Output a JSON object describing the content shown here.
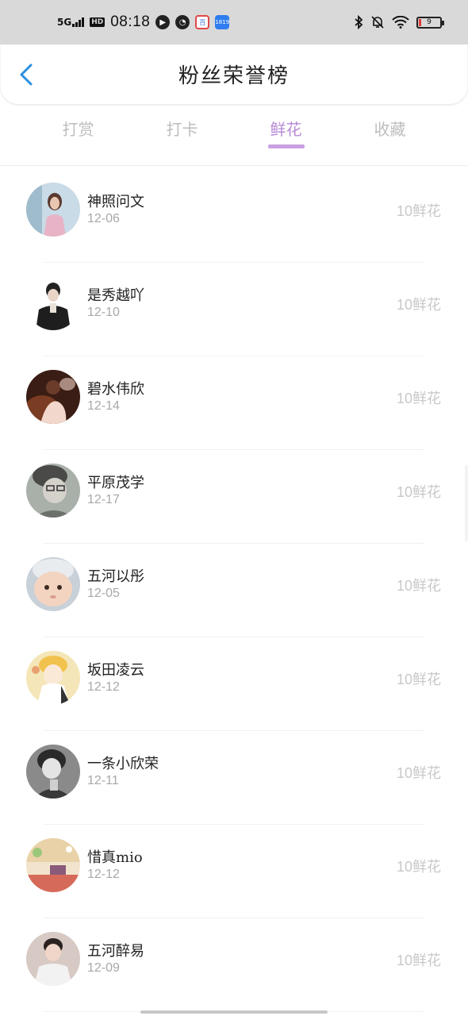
{
  "status_bar": {
    "network": "5G",
    "hd": "HD",
    "time": "08:18",
    "battery": "9",
    "apps": [
      {
        "icon": "media-play-icon",
        "glyph": "▶"
      },
      {
        "icon": "speedometer-icon",
        "glyph": "◔"
      },
      {
        "icon": "baidu-app-icon",
        "glyph": "百"
      },
      {
        "icon": "bilibili-app-icon",
        "glyph": "1819"
      }
    ],
    "right_icons": [
      "bluetooth-icon",
      "mute-bell-icon",
      "wifi-icon",
      "battery-icon"
    ]
  },
  "header": {
    "title": "粉丝荣誉榜",
    "back_icon": "chevron-left-icon"
  },
  "tabs": [
    {
      "label": "打赏",
      "active": false
    },
    {
      "label": "打卡",
      "active": false
    },
    {
      "label": "鲜花",
      "active": true
    },
    {
      "label": "收藏",
      "active": false
    }
  ],
  "accent_color": "#b68ad6",
  "list": [
    {
      "name": "神照问文",
      "date": "12-06",
      "amount": "10鲜花"
    },
    {
      "name": "是秀越吖",
      "date": "12-10",
      "amount": "10鲜花"
    },
    {
      "name": "碧水伟欣",
      "date": "12-14",
      "amount": "10鲜花"
    },
    {
      "name": "平原茂学",
      "date": "12-17",
      "amount": "10鲜花"
    },
    {
      "name": "五河以彤",
      "date": "12-05",
      "amount": "10鲜花"
    },
    {
      "name": "坂田凌云",
      "date": "12-12",
      "amount": "10鲜花"
    },
    {
      "name": "一条小欣荣",
      "date": "12-11",
      "amount": "10鲜花"
    },
    {
      "name": "惜真mio",
      "date": "12-12",
      "amount": "10鲜花"
    },
    {
      "name": "五河醉易",
      "date": "12-09",
      "amount": "10鲜花"
    }
  ]
}
